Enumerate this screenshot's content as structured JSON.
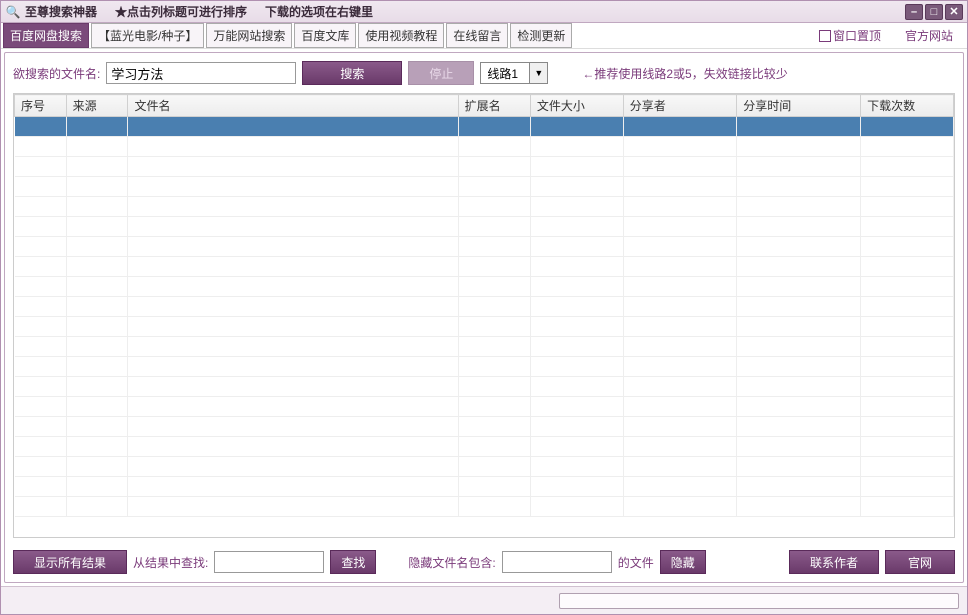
{
  "titlebar": {
    "app_name": "至尊搜索神器",
    "hint1": "★点击列标题可进行排序",
    "hint2": "下载的选项在右键里",
    "minimize": "–",
    "maximize": "□",
    "close": "✕"
  },
  "tabs": {
    "items": [
      {
        "label": "百度网盘搜索",
        "active": true
      },
      {
        "label": "【蓝光电影/种子】",
        "active": false
      },
      {
        "label": "万能网站搜索",
        "active": false
      },
      {
        "label": "百度文库",
        "active": false
      },
      {
        "label": "使用视频教程",
        "active": false
      },
      {
        "label": "在线留言",
        "active": false
      },
      {
        "label": "检测更新",
        "active": false
      }
    ]
  },
  "top_right": {
    "pin_label": "窗口置顶",
    "official_link": "官方网站"
  },
  "search": {
    "label": "欲搜索的文件名:",
    "value": "学习方法",
    "search_btn": "搜索",
    "stop_btn": "停止",
    "route_value": "线路1",
    "hint": "←推荐使用线路2或5，失效链接比较少"
  },
  "table": {
    "headers": {
      "seq": "序号",
      "source": "来源",
      "filename": "文件名",
      "ext": "扩展名",
      "filesize": "文件大小",
      "sharer": "分享者",
      "sharetime": "分享时间",
      "downloads": "下载次数"
    }
  },
  "bottom": {
    "show_all": "显示所有结果",
    "find_label": "从结果中查找:",
    "find_value": "",
    "find_btn": "查找",
    "hide_label": "隐藏文件名包含:",
    "hide_value": "",
    "hide_suffix": "的文件",
    "hide_btn": "隐藏",
    "contact_btn": "联系作者",
    "official_btn": "官网"
  }
}
